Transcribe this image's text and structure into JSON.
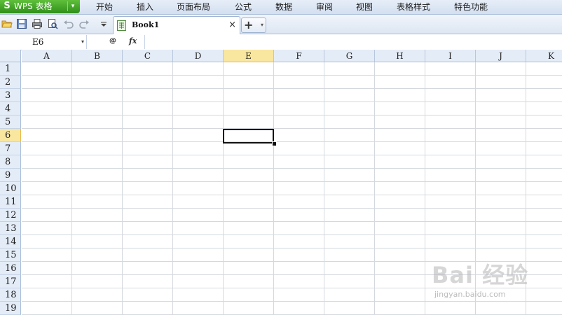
{
  "app": {
    "logo": "S",
    "title": "WPS 表格",
    "brand_color": "#3ea524"
  },
  "menu": [
    "开始",
    "插入",
    "页面布局",
    "公式",
    "数据",
    "审阅",
    "视图",
    "表格样式",
    "特色功能"
  ],
  "toolbar": {
    "icons": [
      "open-folder-icon",
      "save-icon",
      "print-icon",
      "print-preview-icon",
      "undo-icon",
      "redo-icon",
      "customize-dropdown-icon"
    ]
  },
  "tabs": [
    {
      "label": "Book1",
      "close": "×"
    }
  ],
  "new_tab": {
    "label": "+",
    "dropdown": "▾"
  },
  "formula_bar": {
    "cell_ref": "E6",
    "zoom_label": "@",
    "fx_label": "fx",
    "value": ""
  },
  "sheet": {
    "columns": [
      "A",
      "B",
      "C",
      "D",
      "E",
      "F",
      "G",
      "H",
      "I",
      "J",
      "K"
    ],
    "rows": [
      "1",
      "2",
      "3",
      "4",
      "5",
      "6",
      "7",
      "8",
      "9",
      "10",
      "11",
      "12",
      "13",
      "14",
      "15",
      "16",
      "17",
      "18",
      "19"
    ],
    "selected_column": "E",
    "selected_row": "6",
    "active_cell": "E6"
  },
  "watermark": {
    "text": "Bai 经验",
    "sub": "jingyan.baidu.com"
  }
}
